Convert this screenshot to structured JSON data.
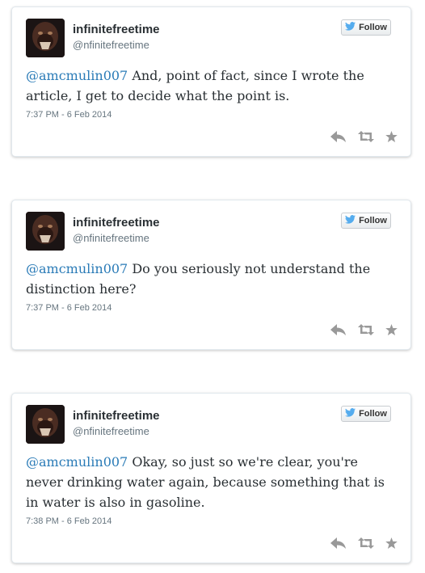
{
  "tweets": [
    {
      "name": "infinitefreetime",
      "handle": "@nfinitefreetime",
      "follow_label": "Follow",
      "mention": "@amcmulin007",
      "text": " And, point of fact, since I wrote the article, I get to decide what the point is.",
      "timestamp": "7:37 PM - 6 Feb 2014"
    },
    {
      "name": "infinitefreetime",
      "handle": "@nfinitefreetime",
      "follow_label": "Follow",
      "mention": "@amcmulin007",
      "text": " Do you seriously not understand the distinction here?",
      "timestamp": "7:37 PM - 6 Feb 2014"
    },
    {
      "name": "infinitefreetime",
      "handle": "@nfinitefreetime",
      "follow_label": "Follow",
      "mention": "@amcmulin007",
      "text": " Okay, so just so we're clear, you're never drinking water again, because something that is in water is also in gasoline.",
      "timestamp": "7:38 PM - 6 Feb 2014"
    }
  ],
  "icons": [
    "bird-icon",
    "reply-icon",
    "retweet-icon",
    "favorite-icon"
  ],
  "colors": {
    "mention": "#2a7bb7",
    "bird": "#55acee",
    "action_icon": "#999999"
  }
}
